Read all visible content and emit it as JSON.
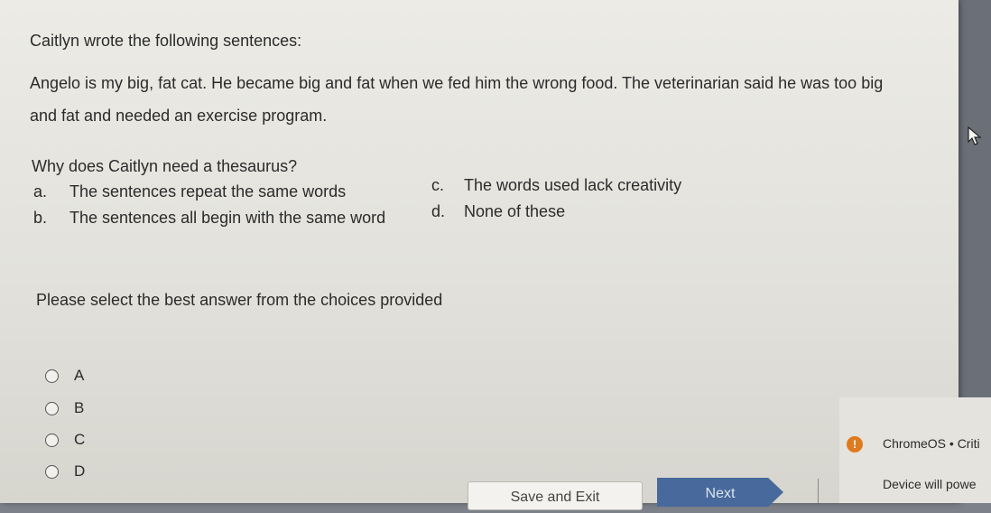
{
  "question": {
    "intro": "Caitlyn wrote the following sentences:",
    "passage_line1": "Angelo is my big, fat cat.  He became big and fat when we fed him the wrong food.  The veterinarian said he was too big",
    "passage_line2": "and fat and needed an exercise program.",
    "prompt": "Why does Caitlyn need a thesaurus?",
    "choices": [
      {
        "letter": "a.",
        "text": "The sentences repeat the same words"
      },
      {
        "letter": "b.",
        "text": "The sentences all begin with the same word"
      },
      {
        "letter": "c.",
        "text": "The words used lack creativity"
      },
      {
        "letter": "d.",
        "text": "None of these"
      }
    ]
  },
  "instruction": "Please select the best answer from the choices provided",
  "answers": [
    {
      "label": "A"
    },
    {
      "label": "B"
    },
    {
      "label": "C"
    },
    {
      "label": "D"
    }
  ],
  "buttons": {
    "save_exit": "Save and Exit",
    "next": "Next"
  },
  "notification": {
    "icon_text": "!",
    "title": "ChromeOS • Criti",
    "body": "Device will powe"
  }
}
